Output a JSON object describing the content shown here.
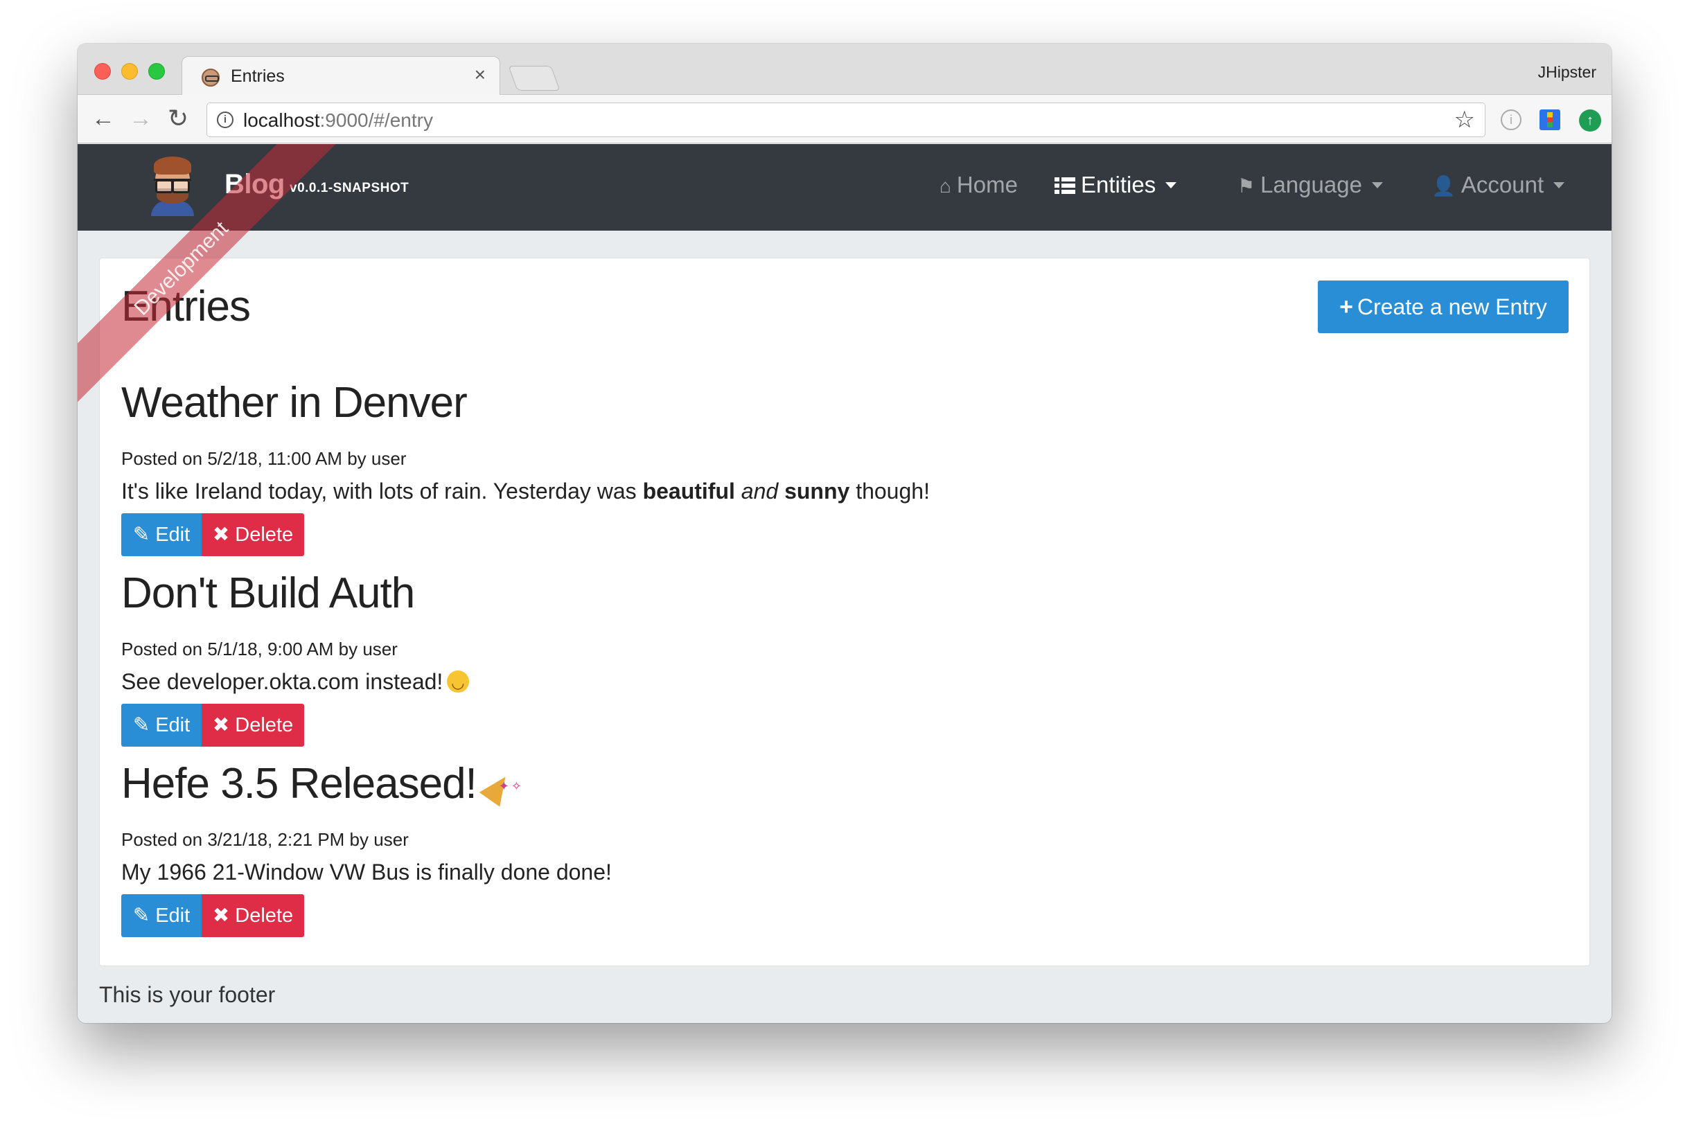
{
  "browser": {
    "tab_title": "Entries",
    "tab_close": "×",
    "profile_name": "JHipster",
    "url_host": "localhost",
    "url_rest": ":9000/#/entry",
    "back_icon": "←",
    "forward_icon": "→",
    "reload_icon": "↻",
    "info_icon": "i",
    "star_icon": "☆",
    "ext1_icon": "i",
    "ext3_icon": "↑"
  },
  "navbar": {
    "brand": "Blog",
    "version": "v0.0.1-SNAPSHOT",
    "ribbon": "Development",
    "home_icon": "⌂",
    "home": "Home",
    "entities": "Entities",
    "language_icon": "⚑",
    "language": "Language",
    "account_icon": "👤",
    "account": "Account"
  },
  "page": {
    "title": "Entries",
    "create_icon": "+",
    "create_label": "Create a new Entry",
    "edit_icon": "✎",
    "edit_label": "Edit",
    "delete_icon": "✖",
    "delete_label": "Delete",
    "footer": "This is your footer"
  },
  "entries": [
    {
      "title": "Weather in Denver",
      "meta": "Posted on 5/2/18, 11:00 AM by user",
      "body_parts": [
        "It's like Ireland today, with lots of rain. Yesterday was ",
        "beautiful",
        " ",
        "and",
        " ",
        "sunny",
        " though!"
      ]
    },
    {
      "title": "Don't Build Auth",
      "meta": "Posted on 5/1/18, 9:00 AM by user",
      "body": "See developer.okta.com instead!",
      "emoji": "smiling-face-icon"
    },
    {
      "title": "Hefe 3.5 Released!",
      "meta": "Posted on 3/21/18, 2:21 PM by user",
      "body": "My 1966 21-Window VW Bus is finally done done!",
      "emoji": "party-popper-icon"
    }
  ],
  "colors": {
    "navbar_bg": "#343a40",
    "primary": "#2a8ed6",
    "danger": "#e02d47",
    "page_bg": "#e9ecef"
  }
}
